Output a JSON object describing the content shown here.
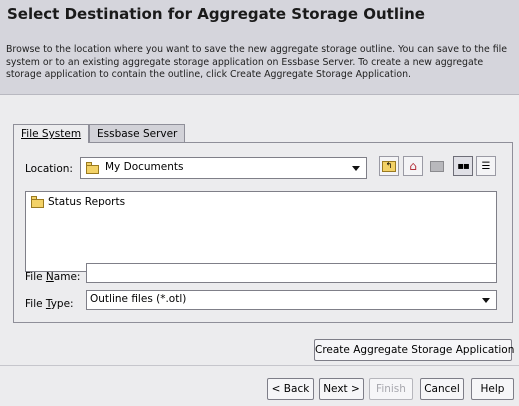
{
  "dialog": {
    "title": "Select Destination for Aggregate Storage Outline",
    "description": "Browse to the location where you want to save the new aggregate storage outline. You can save to the file system or to an existing aggregate storage application on Essbase Server. To create a new aggregate storage application to contain the outline, click Create Aggregate Storage Application."
  },
  "tabs": [
    {
      "label": "File System",
      "active": true
    },
    {
      "label": "Essbase Server",
      "active": false
    }
  ],
  "location": {
    "label": "Location:",
    "value": "My Documents",
    "icons": [
      "up-folder-icon",
      "home-icon",
      "new-folder-icon",
      "list-view-icon",
      "details-view-icon"
    ]
  },
  "files": [
    {
      "name": "Status Reports",
      "icon": "folder-icon"
    }
  ],
  "file_name": {
    "label": "File Name:",
    "value": ""
  },
  "file_type": {
    "label": "File Type:",
    "value": "Outline files (*.otl)"
  },
  "create_button": "Create Aggregate Storage Application",
  "footer": {
    "back": "< Back",
    "next": "Next >",
    "finish": "Finish",
    "cancel": "Cancel",
    "help": "Help"
  }
}
